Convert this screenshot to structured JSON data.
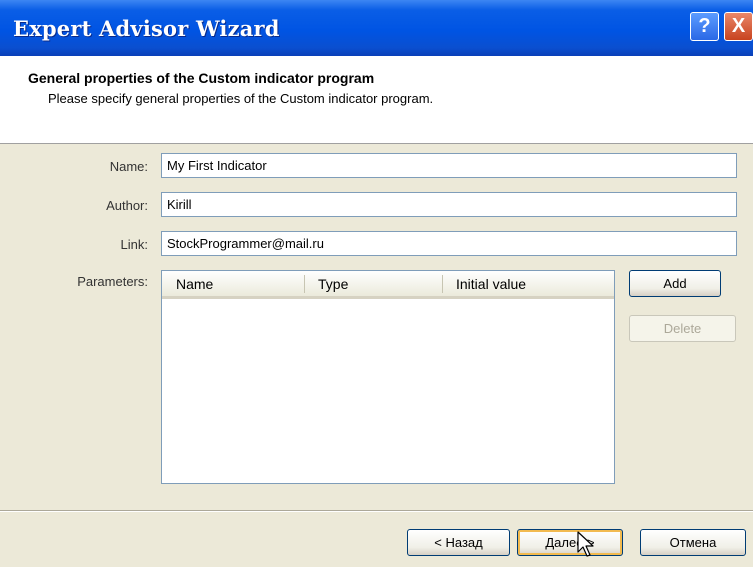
{
  "window": {
    "title": "Expert Advisor Wizard",
    "help_label": "?",
    "close_label": "X"
  },
  "header": {
    "title": "General properties of the Custom indicator program",
    "subtitle": "Please specify general properties of the Custom indicator program."
  },
  "form": {
    "name_label": "Name:",
    "name_value": "My First Indicator",
    "author_label": "Author:",
    "author_value": "Kirill",
    "link_label": "Link:",
    "link_value": "StockProgrammer@mail.ru",
    "parameters_label": "Parameters:"
  },
  "parameters_table": {
    "columns": [
      "Name",
      "Type",
      "Initial value"
    ],
    "rows": []
  },
  "buttons": {
    "add": "Add",
    "delete": "Delete",
    "back": "< Назад",
    "next": "Далее >",
    "cancel": "Отмена"
  }
}
